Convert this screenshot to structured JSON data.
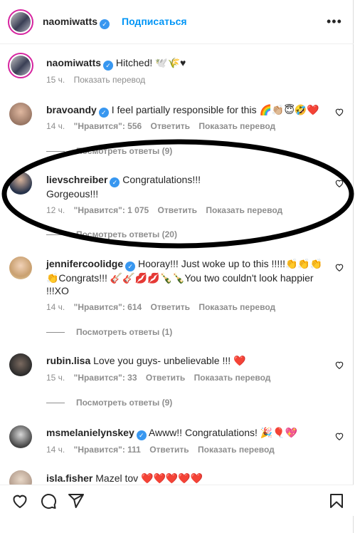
{
  "header": {
    "username": "naomiwatts",
    "follow_label": "Подписаться",
    "more_glyph": "•••"
  },
  "caption": {
    "username": "naomiwatts",
    "text": "Hitched! 🕊️🌾♥",
    "time": "15 ч.",
    "translate": "Показать перевод"
  },
  "comments": [
    {
      "username": "bravoandy",
      "verified": true,
      "text": "I feel partially responsible for this 🌈👏🏼😇🤣❤️",
      "time": "14 ч.",
      "likes": "\"Нравится\": 556",
      "reply": "Ответить",
      "translate": "Показать перевод",
      "replies": "Посмотреть ответы (9)"
    },
    {
      "username": "lievschreiber",
      "verified": true,
      "text": "Congratulations!!!",
      "text2": "Gorgeous!!!",
      "time": "12 ч.",
      "likes": "\"Нравится\": 1 075",
      "reply": "Ответить",
      "translate": "Показать перевод",
      "replies": "Посмотреть ответы (20)"
    },
    {
      "username": "jennifercoolidge",
      "verified": true,
      "text": "Hooray!!! Just woke up to this !!!!!👏👏👏",
      "text2": "👏Congrats!!! 🎸🎸💋💋🍾🍾You two couldn't look happier",
      "text3": "!!!XO",
      "time": "14 ч.",
      "likes": "\"Нравится\": 614",
      "reply": "Ответить",
      "translate": "Показать перевод",
      "replies": "Посмотреть ответы (1)"
    },
    {
      "username": "rubin.lisa",
      "verified": false,
      "text": "Love you guys- unbelievable !!! ❤️",
      "time": "15 ч.",
      "likes": "\"Нравится\": 33",
      "reply": "Ответить",
      "translate": "Показать перевод",
      "replies": "Посмотреть ответы (9)"
    },
    {
      "username": "msmelanielynskey",
      "verified": true,
      "text": "Awww!! Congratulations! 🎉🎈💖",
      "time": "14 ч.",
      "likes": "\"Нравится\": 111",
      "reply": "Ответить",
      "translate": "Показать перевод"
    },
    {
      "username": "isla.fisher",
      "verified": false,
      "text": "Mazel tov ❤️❤️❤️❤️❤️"
    }
  ],
  "colors": {
    "accent": "#0095f6",
    "verified": "#3897f0",
    "annotation": "#000000"
  },
  "icons": [
    "more-icon",
    "heart-icon",
    "comment-icon",
    "share-icon",
    "bookmark-icon",
    "verified-icon"
  ]
}
